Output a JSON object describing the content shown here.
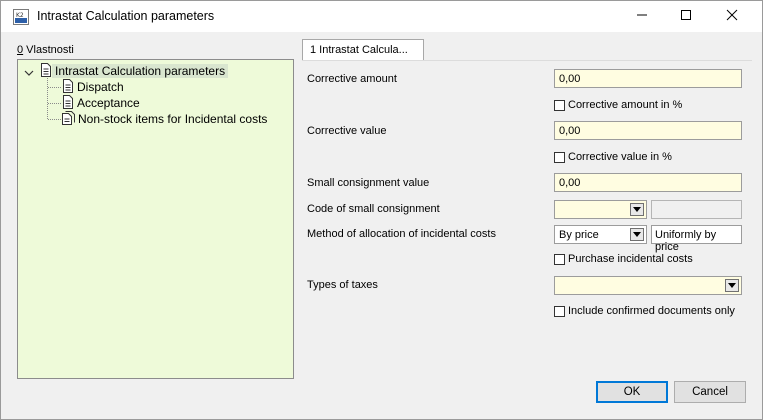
{
  "window": {
    "title": "Intrastat Calculation parameters"
  },
  "tree": {
    "caption_mnemonic": "0",
    "caption_rest": " Vlastnosti",
    "root": "Intrastat Calculation parameters",
    "children": [
      "Dispatch",
      "Acceptance",
      "Non-stock items for Incidental costs"
    ]
  },
  "tab": {
    "label": "1 Intrastat Calcula..."
  },
  "form": {
    "corrective_amount": {
      "label": "Corrective amount",
      "value": "0,00"
    },
    "corrective_amount_pct": {
      "label": "Corrective amount in %",
      "checked": false
    },
    "corrective_value": {
      "label": "Corrective value",
      "value": "0,00"
    },
    "corrective_value_pct": {
      "label": "Corrective value in %",
      "checked": false
    },
    "small_consignment_value": {
      "label": "Small consignment value",
      "value": "0,00"
    },
    "code_small_consignment": {
      "label": "Code of small consignment",
      "value": "",
      "desc": ""
    },
    "allocation_method": {
      "label": "Method of allocation of incidental costs",
      "value": "By price",
      "desc": "Uniformly by price"
    },
    "purchase_incidental": {
      "label": "Purchase incidental costs",
      "checked": false
    },
    "types_of_taxes": {
      "label": "Types of taxes",
      "value": ""
    },
    "include_confirmed": {
      "label": "Include confirmed documents only",
      "checked": false
    }
  },
  "buttons": {
    "ok": "OK",
    "cancel": "Cancel"
  }
}
